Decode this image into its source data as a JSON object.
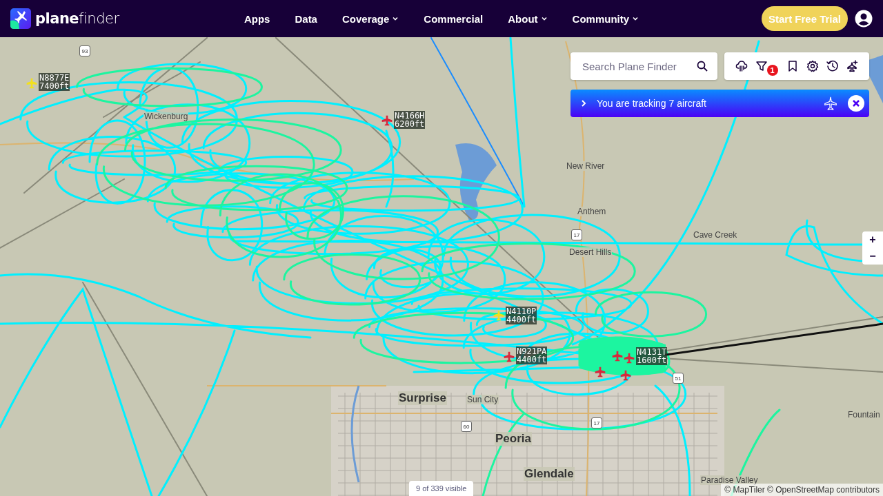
{
  "header": {
    "logo": "**plane**finder",
    "nav": [
      {
        "label": "Apps",
        "has_menu": false
      },
      {
        "label": "Data",
        "has_menu": false
      },
      {
        "label": "Coverage",
        "has_menu": true
      },
      {
        "label": "Commercial",
        "has_menu": false
      },
      {
        "label": "About",
        "has_menu": true
      },
      {
        "label": "Community",
        "has_menu": true
      }
    ],
    "cta": "Start Free Trial"
  },
  "search": {
    "placeholder": "Search Plane Finder"
  },
  "toolbar": {
    "filter_badge": "1"
  },
  "tracking_banner": {
    "text": "You are tracking 7 aircraft"
  },
  "zoom": {
    "zoom_in": "+",
    "zoom_out": "−"
  },
  "map": {
    "places": [
      {
        "name": "Wickenburg",
        "kind": "town"
      },
      {
        "name": "New River",
        "kind": "town"
      },
      {
        "name": "Anthem",
        "kind": "town"
      },
      {
        "name": "Desert Hills",
        "kind": "town"
      },
      {
        "name": "Cave Creek",
        "kind": "town"
      },
      {
        "name": "Surprise",
        "kind": "city"
      },
      {
        "name": "Sun City",
        "kind": "town"
      },
      {
        "name": "Peoria",
        "kind": "city"
      },
      {
        "name": "Glendale",
        "kind": "city"
      },
      {
        "name": "Paradise Valley",
        "kind": "town"
      },
      {
        "name": "Fountain",
        "kind": "town"
      }
    ],
    "shields": [
      "93",
      "17",
      "51",
      "60",
      "17"
    ],
    "aircraft": [
      {
        "callsign": "N8877E",
        "altitude": "7400ft",
        "color": "#f2e01e"
      },
      {
        "callsign": "N4166H",
        "altitude": "6200ft",
        "color": "#d8283c"
      },
      {
        "callsign": "N4110P",
        "altitude": "4400ft",
        "color": "#f2e01e"
      },
      {
        "callsign": "N921PA",
        "altitude": "4400ft",
        "color": "#d8283c"
      },
      {
        "callsign": "N4131T",
        "altitude": "1600ft",
        "color": "#d8283c"
      },
      {
        "color": "#d8283c"
      },
      {
        "color": "#d8283c"
      },
      {
        "color": "#d8283c"
      }
    ]
  },
  "footer": {
    "visible_count": "9 of 339 visible",
    "attribution": "© MapTiler © OpenStreetMap contributors"
  }
}
